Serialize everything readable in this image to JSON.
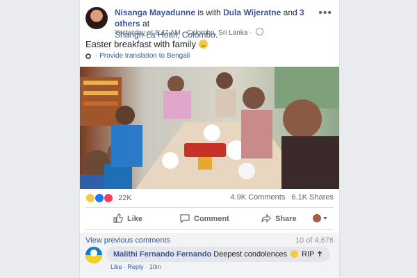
{
  "post": {
    "author": "Nisanga Mayadunne",
    "is_with": "is with",
    "tagged": "Dula Wijeratne",
    "and": "and",
    "others": "3 others",
    "at": "at",
    "place": "Shangri-La Hotel, Colombo",
    "place_end": ".",
    "time": "Yesterday at 8:47 AM",
    "dot": "·",
    "location": "Colombo, Sri Lanka",
    "dot2": "·",
    "text": "Easter breakfast with family",
    "translate": "Provide translation to Bengali",
    "more_icon": "more-options-icon",
    "more_glyph": "•••"
  },
  "stats": {
    "reactions_count": "22K",
    "comments": "4.9K Comments",
    "shares": "6.1K Shares",
    "reaction_icons": [
      "sad-icon",
      "like-icon",
      "love-icon"
    ]
  },
  "actions": {
    "like": "Like",
    "comment": "Comment",
    "share": "Share"
  },
  "comments": {
    "view_previous": "View previous comments",
    "page_count": "10 of 4,676",
    "items": [
      {
        "name": "Malithi Fernando Fernando",
        "text": "Deepest condolences",
        "suffix": "RIP ✝",
        "like": "Like",
        "sep": "·",
        "reply": "Reply",
        "sep2": "·",
        "time": "10m"
      }
    ]
  },
  "colors": {
    "link": "#385898",
    "background": "#e9ebee",
    "like_blue": "#1877f2",
    "love_red": "#f33e58"
  }
}
